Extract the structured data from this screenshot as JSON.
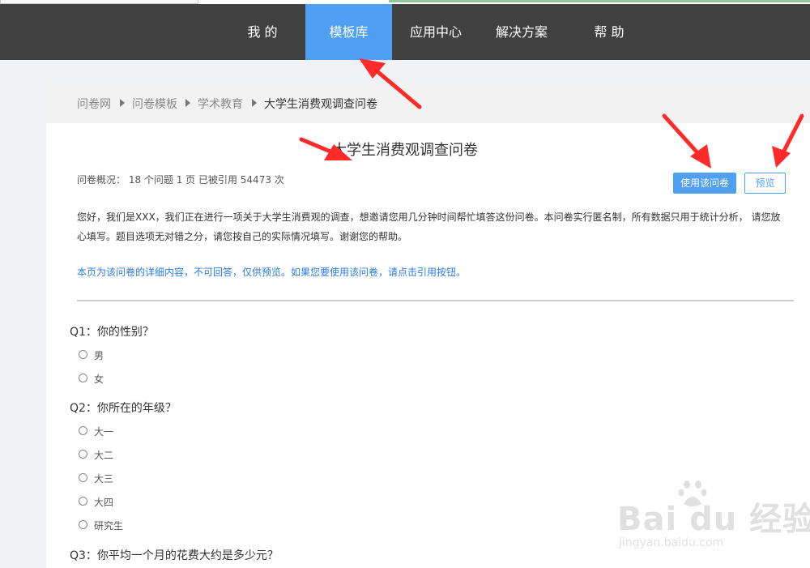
{
  "nav": {
    "items": [
      {
        "label": "我 的",
        "active": false
      },
      {
        "label": "模板库",
        "active": true
      },
      {
        "label": "应用中心",
        "active": false
      },
      {
        "label": "解决方案",
        "active": false
      },
      {
        "label": "帮 助",
        "active": false
      }
    ]
  },
  "breadcrumb": [
    "问卷网",
    "问卷模板",
    "学术教育",
    "大学生消费观调查问卷"
  ],
  "survey": {
    "title": "大学生消费观调查问卷",
    "overview": "问卷概况： 18 个问题 1 页 已被引用 54473 次",
    "use_button": "使用该问卷",
    "preview_button": "预览",
    "intro": "您好，我们是XXX，我们正在进行一项关于大学生消费观的调查，想邀请您用几分钟时间帮忙填答这份问卷。本问卷实行匿名制，所有数据只用于统计分析， 请您放心填写。题目选项无对错之分，请您按自己的实际情况填写。谢谢您的帮助。",
    "notice": "本页为该问卷的详细内容，不可回答，仅供预览。如果您要使用该问卷，请点击引用按钮。"
  },
  "questions": [
    {
      "title": "Q1：你的性别？",
      "options": [
        "男",
        "女"
      ]
    },
    {
      "title": "Q2：你所在的年级？",
      "options": [
        "大一",
        "大二",
        "大三",
        "大四",
        "研究生"
      ]
    },
    {
      "title": "Q3：你平均一个月的花费大约是多少元？",
      "options": []
    }
  ],
  "watermark": {
    "brand": "Bai du 经验",
    "url": "jingyan.baidu.com"
  },
  "colors": {
    "nav_bg": "#414141",
    "accent": "#4f9ff5",
    "notice": "#2b7be4",
    "arrow": "#ff2a2a"
  }
}
